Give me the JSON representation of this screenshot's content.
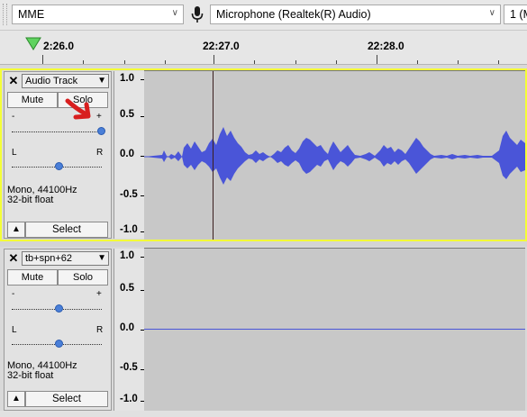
{
  "toolbar": {
    "host": "MME",
    "input_device": "Microphone (Realtek(R) Audio)",
    "channels": "1 (M"
  },
  "icons": {
    "mic": "microphone-icon",
    "play_head": "playback-head-icon",
    "arrow_annotation": "red-arrow-annotation"
  },
  "ruler": {
    "labels": [
      "2:26.0",
      "22:27.0",
      "22:28.0"
    ]
  },
  "tracks": [
    {
      "name": "Audio Track",
      "mute": "Mute",
      "solo": "Solo",
      "gain_minus": "-",
      "gain_plus": "+",
      "pan_left": "L",
      "pan_right": "R",
      "info_line1": "Mono, 44100Hz",
      "info_line2": "32-bit float",
      "select": "Select",
      "scale": [
        "1.0",
        "0.5",
        "0.0",
        "-0.5",
        "-1.0"
      ]
    },
    {
      "name": "tb+spn+62",
      "mute": "Mute",
      "solo": "Solo",
      "gain_minus": "-",
      "gain_plus": "+",
      "pan_left": "L",
      "pan_right": "R",
      "info_line1": "Mono, 44100Hz",
      "info_line2": "32-bit float",
      "select": "Select",
      "scale": [
        "1.0",
        "0.5",
        "0.0",
        "-0.5",
        "-1.0"
      ]
    }
  ],
  "colors": {
    "waveform": "#4a55d8",
    "selected_border": "#f4ff36",
    "annotation": "#d81e1e"
  }
}
